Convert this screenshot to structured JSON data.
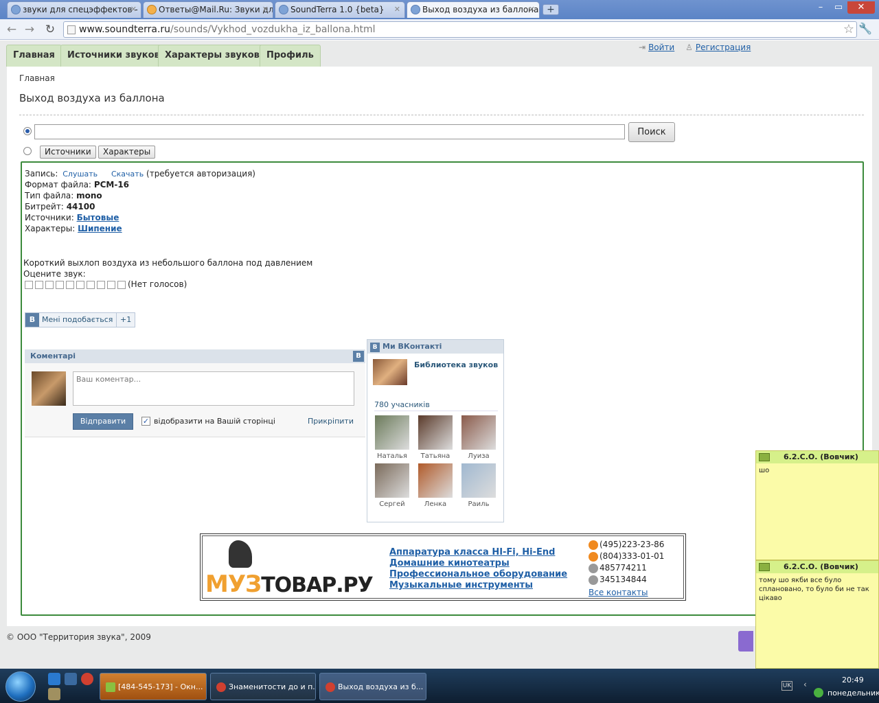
{
  "browser": {
    "tabs": [
      {
        "label": "звуки для спецэффектов - П"
      },
      {
        "label": "Ответы@Mail.Ru: Звуки для"
      },
      {
        "label": "SoundTerra 1.0 {beta}"
      },
      {
        "label": "Выход воздуха из баллона"
      }
    ],
    "new_tab": "+",
    "url_host": "www.soundterra.ru",
    "url_path": "/sounds/Vykhod_vozdukha_iz_ballona.html",
    "min": "–",
    "max": "▭",
    "close": "✕"
  },
  "nav": {
    "tabs": [
      {
        "label": "Главная"
      },
      {
        "label": "Источники звуков"
      },
      {
        "label": "Характеры звуков"
      },
      {
        "label": "Профиль"
      }
    ],
    "login": "Войти",
    "register": "Регистрация"
  },
  "page": {
    "breadcrumb": "Главная",
    "title": "Выход воздуха из баллона",
    "search_button": "Поиск",
    "sources_button": "Источники",
    "characters_button": "Характеры"
  },
  "sound": {
    "record_label": "Запись:",
    "listen": "Слушать",
    "download": "Скачать",
    "auth_note": "(требуется авторизация)",
    "format_label": "Формат файла:",
    "format_value": "PCM-16",
    "type_label": "Тип файла:",
    "type_value": "mono",
    "bitrate_label": "Битрейт:",
    "bitrate_value": "44100",
    "sources_label": "Источники:",
    "sources_value": "Бытовые",
    "chars_label": "Характеры:",
    "chars_value": "Шипение",
    "description": "Короткий выхлоп воздуха из небольшого баллона под давлением",
    "rate_label": "Оцените звук:",
    "votes": "(Нет голосов)",
    "rating": {
      "value": 0,
      "max": 10
    }
  },
  "vk_like": {
    "icon": "В",
    "label": "Мені подобається",
    "plus": "+1"
  },
  "comments": {
    "header": "Коментарі",
    "vk_icon": "В",
    "placeholder": "Ваш коментар...",
    "send": "Відправити",
    "check_mark": "✓",
    "show_on_page": "відобразити на Вашій сторінці",
    "attach": "Прикріпити"
  },
  "vk_group": {
    "header": "Ми ВКонтакті",
    "vk_icon": "В",
    "group_name": "Библиотека звуков",
    "members_count": "780 учасників",
    "members": [
      {
        "name": "Наталья",
        "color": "#6b7a5a"
      },
      {
        "name": "Татьяна",
        "color": "#5a3a2a"
      },
      {
        "name": "Луиза",
        "color": "#8a5a4a"
      },
      {
        "name": "Сергей",
        "color": "#7a6a5a"
      },
      {
        "name": "Ленка",
        "color": "#b05a2a"
      },
      {
        "name": "Раиль",
        "color": "#a0b8d0"
      }
    ]
  },
  "banner": {
    "logo_part1": "МУЗ",
    "logo_part2": "ТОВАР.РУ",
    "links": [
      {
        "label": "Аппаратура класса HI-Fi, Hi-End"
      },
      {
        "label": "Домашние кинотеатры"
      },
      {
        "label": "Профессиональное оборудование"
      },
      {
        "label": "Музыкальные инструменты"
      }
    ],
    "phones": [
      {
        "label": "(495)223-23-86",
        "icon": "phone-icon",
        "color": "#f08a20"
      },
      {
        "label": "(804)333-01-01",
        "icon": "phone-icon",
        "color": "#f08a20"
      },
      {
        "label": "485774211",
        "icon": "icq-icon",
        "color": "#999999"
      },
      {
        "label": "345134844",
        "icon": "icq-icon",
        "color": "#999999"
      }
    ],
    "all_contacts": "Все контакты"
  },
  "footer": {
    "copyright": "© ООО \"Территория звука\", 2009"
  },
  "notes": [
    {
      "title": "6.2.С.О. (Вовчик)",
      "text": "шо"
    },
    {
      "title": "6.2.С.О. (Вовчик)",
      "text": "тому шо якби все було сплановано, то було би не так цікаво"
    }
  ],
  "taskbar": {
    "tasks": [
      {
        "label": "[484-545-173] - Окн..."
      },
      {
        "label": "Знаменитости до и п..."
      },
      {
        "label": "Выход воздуха из б..."
      }
    ],
    "lang": "UK",
    "time": "20:49",
    "day": "понедельник"
  },
  "colors": {
    "accent_green": "#3b8a3b",
    "nav_tab": "#d4e6c6",
    "vk_blue": "#5b7fa6"
  }
}
